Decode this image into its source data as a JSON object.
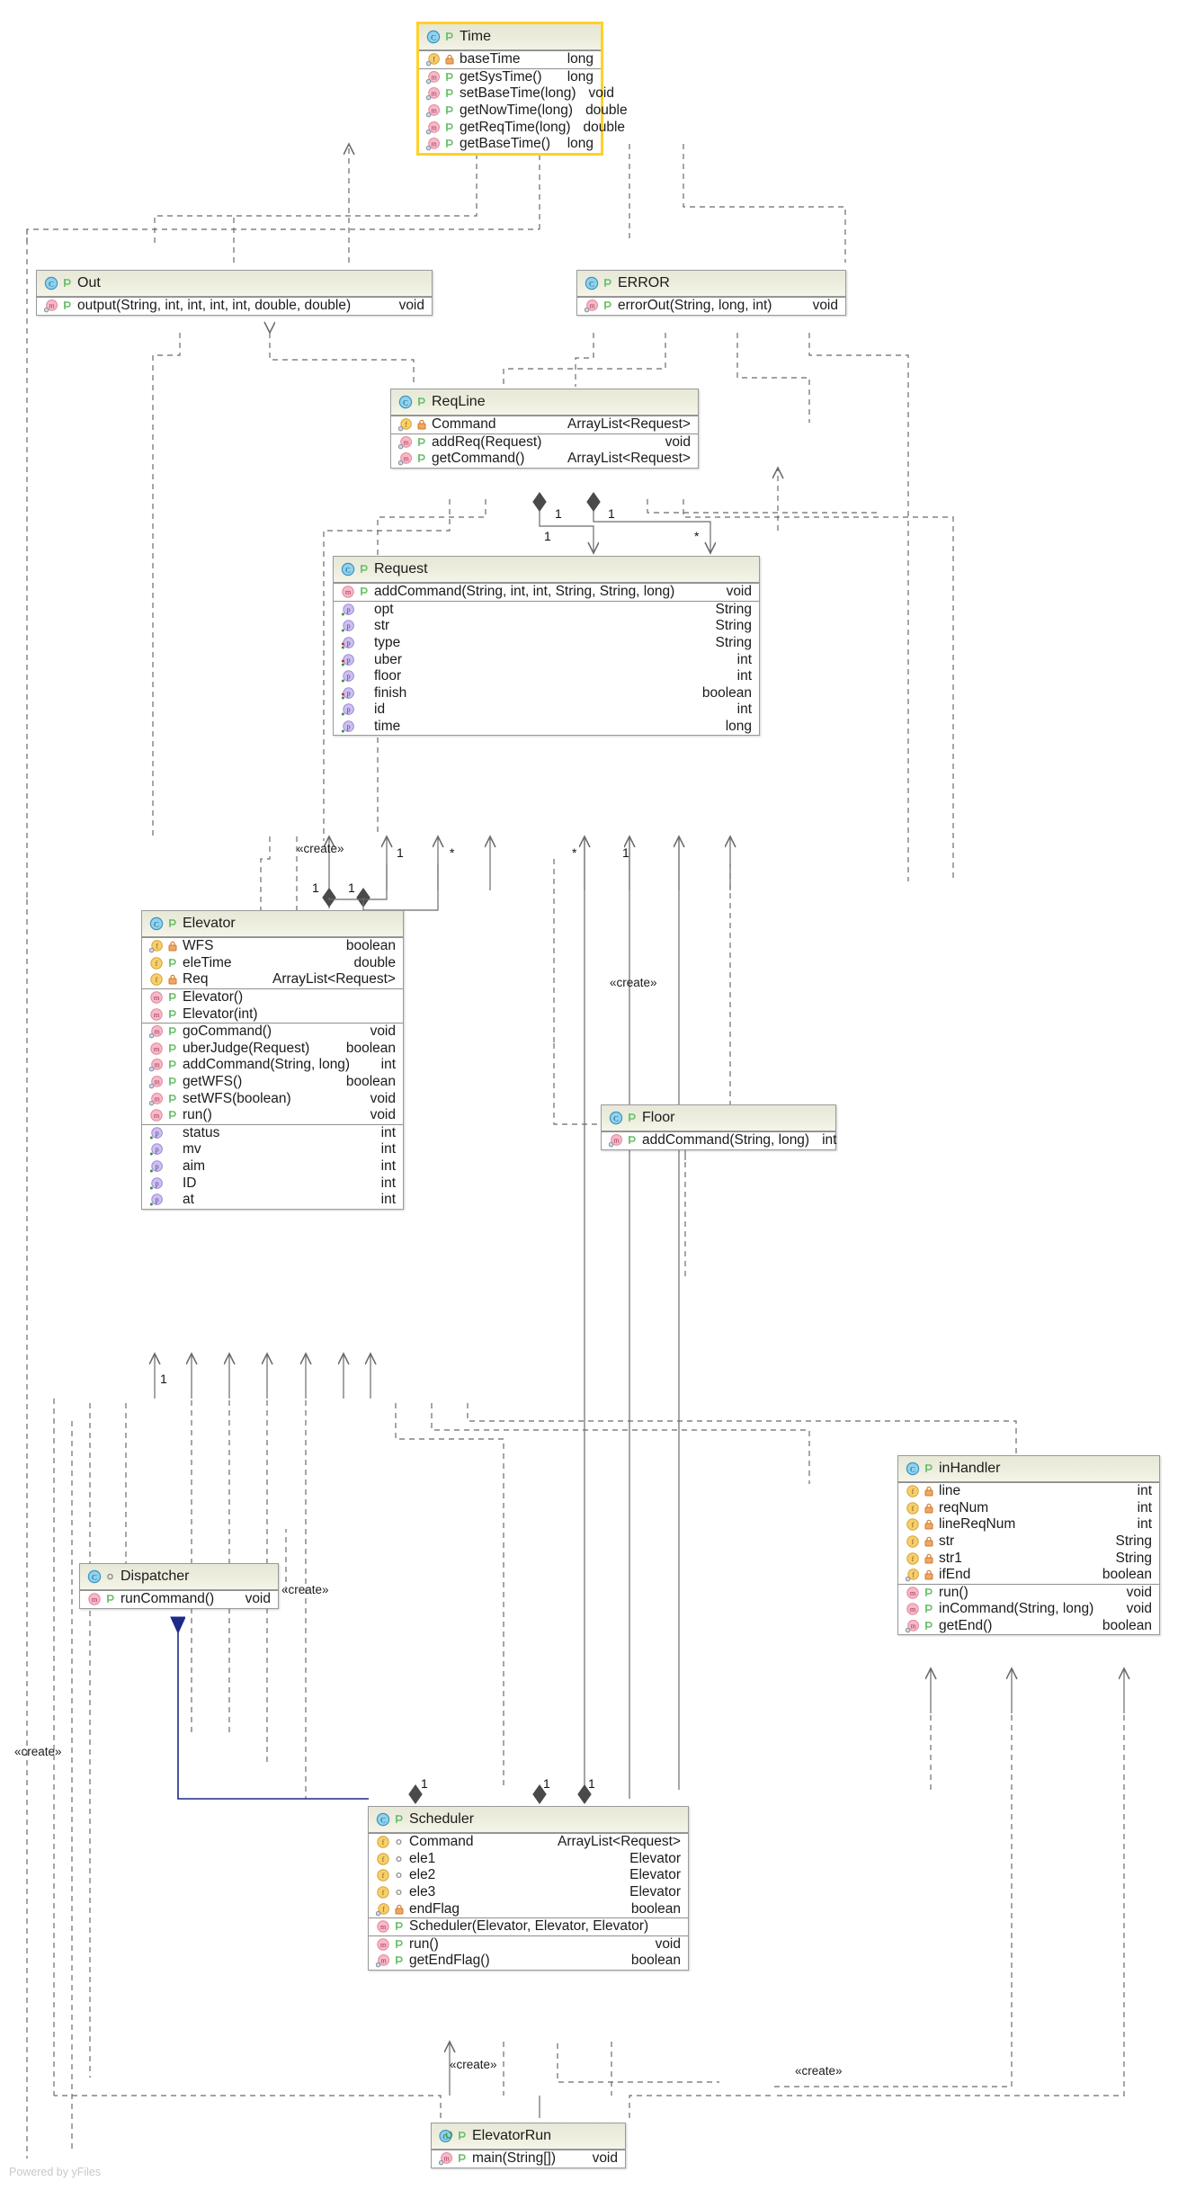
{
  "diagram": {
    "kind": "uml-class-diagram",
    "watermark": "Powered by yFiles",
    "colors": {
      "node_border": "#9a9a9a",
      "node_fill": "#ffffff",
      "title_fill": "#ececdc",
      "selection": "#ffd12b",
      "edge": "#6b6b6b",
      "edge_highlight": "#1c2a8a",
      "class_icon": "#4aa8d8",
      "method_icon": "#f1a0b5",
      "field_icon": "#f5c243",
      "property_icon": "#c0aee8",
      "lock_private": "#e8954f"
    },
    "stereotypes": {
      "create": "«create»"
    },
    "multiplicities": {
      "one": "1",
      "many": "*"
    }
  },
  "classes": {
    "time": {
      "name": "Time",
      "icon": "class-icon",
      "visibility": "public",
      "selected": true,
      "sections": [
        {
          "members": [
            {
              "icon": "field-static-icon",
              "vis": "private-lock-icon",
              "name": "baseTime",
              "type": "long"
            }
          ]
        },
        {
          "members": [
            {
              "icon": "method-static-icon",
              "vis": "public-icon",
              "name": "getSysTime()",
              "type": "long"
            },
            {
              "icon": "method-static-icon",
              "vis": "public-icon",
              "name": "setBaseTime(long)",
              "type": "void"
            },
            {
              "icon": "method-static-icon",
              "vis": "public-icon",
              "name": "getNowTime(long)",
              "type": "double"
            },
            {
              "icon": "method-static-icon",
              "vis": "public-icon",
              "name": "getReqTime(long)",
              "type": "double"
            },
            {
              "icon": "method-static-icon",
              "vis": "public-icon",
              "name": "getBaseTime()",
              "type": "long"
            }
          ]
        }
      ]
    },
    "out": {
      "name": "Out",
      "icon": "class-icon",
      "visibility": "public",
      "sections": [
        {
          "members": [
            {
              "icon": "method-static-icon",
              "vis": "public-icon",
              "name": "output(String, int, int, int, int, double, double)",
              "type": "void"
            }
          ]
        }
      ]
    },
    "error": {
      "name": "ERROR",
      "icon": "class-icon",
      "visibility": "public",
      "sections": [
        {
          "members": [
            {
              "icon": "method-static-icon",
              "vis": "public-icon",
              "name": "errorOut(String, long, int)",
              "type": "void"
            }
          ]
        }
      ]
    },
    "reqline": {
      "name": "ReqLine",
      "icon": "class-icon",
      "visibility": "public",
      "sections": [
        {
          "members": [
            {
              "icon": "field-static-icon",
              "vis": "private-lock-icon",
              "name": "Command",
              "type": "ArrayList<Request>"
            }
          ]
        },
        {
          "members": [
            {
              "icon": "method-static-icon",
              "vis": "public-icon",
              "name": "addReq(Request)",
              "type": "void"
            },
            {
              "icon": "method-static-icon",
              "vis": "public-icon",
              "name": "getCommand()",
              "type": "ArrayList<Request>"
            }
          ]
        }
      ]
    },
    "request": {
      "name": "Request",
      "icon": "class-icon",
      "visibility": "public",
      "sections": [
        {
          "members": [
            {
              "icon": "method-icon",
              "vis": "public-icon",
              "name": "addCommand(String, int, int, String, String, long)",
              "type": "void"
            }
          ]
        },
        {
          "members": [
            {
              "icon": "property-icon",
              "vis": "none",
              "name": "opt",
              "type": "String"
            },
            {
              "icon": "property-icon",
              "vis": "none",
              "name": "str",
              "type": "String"
            },
            {
              "icon": "property-icon",
              "vis": "none",
              "name": "type",
              "type": "String"
            },
            {
              "icon": "property-icon",
              "vis": "none",
              "name": "uber",
              "type": "int"
            },
            {
              "icon": "property-icon",
              "vis": "none",
              "name": "floor",
              "type": "int"
            },
            {
              "icon": "property-icon",
              "vis": "none",
              "name": "finish",
              "type": "boolean"
            },
            {
              "icon": "property-icon",
              "vis": "none",
              "name": "id",
              "type": "int"
            },
            {
              "icon": "property-icon",
              "vis": "none",
              "name": "time",
              "type": "long"
            }
          ]
        }
      ]
    },
    "elevator": {
      "name": "Elevator",
      "icon": "class-icon",
      "visibility": "public",
      "sections": [
        {
          "members": [
            {
              "icon": "field-static-icon",
              "vis": "private-lock-icon",
              "name": "WFS",
              "type": "boolean"
            },
            {
              "icon": "field-icon",
              "vis": "public-icon",
              "name": "eleTime",
              "type": "double"
            },
            {
              "icon": "field-icon",
              "vis": "private-lock-icon",
              "name": "Req",
              "type": "ArrayList<Request>"
            }
          ]
        },
        {
          "members": [
            {
              "icon": "method-icon",
              "vis": "public-icon",
              "name": "Elevator()",
              "type": ""
            },
            {
              "icon": "method-icon",
              "vis": "public-icon",
              "name": "Elevator(int)",
              "type": ""
            }
          ]
        },
        {
          "members": [
            {
              "icon": "method-static-icon",
              "vis": "public-icon",
              "name": "goCommand()",
              "type": "void"
            },
            {
              "icon": "method-icon",
              "vis": "public-icon",
              "name": "uberJudge(Request)",
              "type": "boolean"
            },
            {
              "icon": "method-static-icon",
              "vis": "public-icon",
              "name": "addCommand(String, long)",
              "type": "int"
            },
            {
              "icon": "method-static-icon",
              "vis": "public-icon",
              "name": "getWFS()",
              "type": "boolean"
            },
            {
              "icon": "method-static-icon",
              "vis": "public-icon",
              "name": "setWFS(boolean)",
              "type": "void"
            },
            {
              "icon": "method-icon",
              "vis": "public-icon",
              "name": "run()",
              "type": "void"
            }
          ]
        },
        {
          "members": [
            {
              "icon": "property-icon",
              "vis": "none",
              "name": "status",
              "type": "int"
            },
            {
              "icon": "property-icon",
              "vis": "none",
              "name": "mv",
              "type": "int"
            },
            {
              "icon": "property-icon",
              "vis": "none",
              "name": "aim",
              "type": "int"
            },
            {
              "icon": "property-icon",
              "vis": "none",
              "name": "ID",
              "type": "int"
            },
            {
              "icon": "property-icon",
              "vis": "none",
              "name": "at",
              "type": "int"
            }
          ]
        }
      ]
    },
    "floor": {
      "name": "Floor",
      "icon": "class-icon",
      "visibility": "public",
      "sections": [
        {
          "members": [
            {
              "icon": "method-static-icon",
              "vis": "public-icon",
              "name": "addCommand(String, long)",
              "type": "int"
            }
          ]
        }
      ]
    },
    "inhandler": {
      "name": "inHandler",
      "icon": "class-icon",
      "visibility": "public",
      "sections": [
        {
          "members": [
            {
              "icon": "field-icon",
              "vis": "private-lock-icon",
              "name": "line",
              "type": "int"
            },
            {
              "icon": "field-icon",
              "vis": "private-lock-icon",
              "name": "reqNum",
              "type": "int"
            },
            {
              "icon": "field-icon",
              "vis": "private-lock-icon",
              "name": "lineReqNum",
              "type": "int"
            },
            {
              "icon": "field-icon",
              "vis": "private-lock-icon",
              "name": "str",
              "type": "String"
            },
            {
              "icon": "field-icon",
              "vis": "private-lock-icon",
              "name": "str1",
              "type": "String"
            },
            {
              "icon": "field-static-icon",
              "vis": "private-lock-icon",
              "name": "ifEnd",
              "type": "boolean"
            }
          ]
        },
        {
          "members": [
            {
              "icon": "method-icon",
              "vis": "public-icon",
              "name": "run()",
              "type": "void"
            },
            {
              "icon": "method-icon",
              "vis": "public-icon",
              "name": "inCommand(String, long)",
              "type": "void"
            },
            {
              "icon": "method-static-icon",
              "vis": "public-icon",
              "name": "getEnd()",
              "type": "boolean"
            }
          ]
        }
      ]
    },
    "dispatcher": {
      "name": "Dispatcher",
      "icon": "class-icon",
      "visibility": "package",
      "sections": [
        {
          "members": [
            {
              "icon": "method-icon",
              "vis": "public-icon",
              "name": "runCommand()",
              "type": "void"
            }
          ]
        }
      ]
    },
    "scheduler": {
      "name": "Scheduler",
      "icon": "class-icon",
      "visibility": "public",
      "sections": [
        {
          "members": [
            {
              "icon": "field-icon",
              "vis": "package-icon",
              "name": "Command",
              "type": "ArrayList<Request>"
            },
            {
              "icon": "field-icon",
              "vis": "package-icon",
              "name": "ele1",
              "type": "Elevator"
            },
            {
              "icon": "field-icon",
              "vis": "package-icon",
              "name": "ele2",
              "type": "Elevator"
            },
            {
              "icon": "field-icon",
              "vis": "package-icon",
              "name": "ele3",
              "type": "Elevator"
            },
            {
              "icon": "field-static-icon",
              "vis": "private-lock-icon",
              "name": "endFlag",
              "type": "boolean"
            }
          ]
        },
        {
          "members": [
            {
              "icon": "method-icon",
              "vis": "public-icon",
              "name": "Scheduler(Elevator, Elevator, Elevator)",
              "type": ""
            }
          ]
        },
        {
          "members": [
            {
              "icon": "method-icon",
              "vis": "public-icon",
              "name": "run()",
              "type": "void"
            },
            {
              "icon": "method-static-icon",
              "vis": "public-icon",
              "name": "getEndFlag()",
              "type": "boolean"
            }
          ]
        }
      ]
    },
    "elevatorrun": {
      "name": "ElevatorRun",
      "icon": "class-runnable-icon",
      "visibility": "public",
      "sections": [
        {
          "members": [
            {
              "icon": "method-static-icon",
              "vis": "public-icon",
              "name": "main(String[])",
              "type": "void"
            }
          ]
        }
      ]
    }
  },
  "edge_labels": [
    {
      "id": "create-req-elevator",
      "text": "«create»"
    },
    {
      "id": "create-req-floor",
      "text": "«create»"
    },
    {
      "id": "create-dispatcher",
      "text": "«create»"
    },
    {
      "id": "create-left",
      "text": "«create»"
    },
    {
      "id": "create-scheduler",
      "text": "«create»"
    },
    {
      "id": "create-run-right",
      "text": "«create»"
    }
  ],
  "multiplicity_labels": [
    {
      "id": "m1",
      "text": "1"
    },
    {
      "id": "m2",
      "text": "1"
    },
    {
      "id": "m3",
      "text": "1"
    },
    {
      "id": "m4",
      "text": "*"
    },
    {
      "id": "m5",
      "text": "1"
    },
    {
      "id": "m6",
      "text": "1"
    },
    {
      "id": "m7",
      "text": "1"
    },
    {
      "id": "m8",
      "text": "*"
    },
    {
      "id": "m9",
      "text": "*"
    },
    {
      "id": "m10",
      "text": "1"
    },
    {
      "id": "m11",
      "text": "1"
    },
    {
      "id": "m12",
      "text": "1"
    },
    {
      "id": "m13",
      "text": "1"
    },
    {
      "id": "m14",
      "text": "1"
    }
  ]
}
